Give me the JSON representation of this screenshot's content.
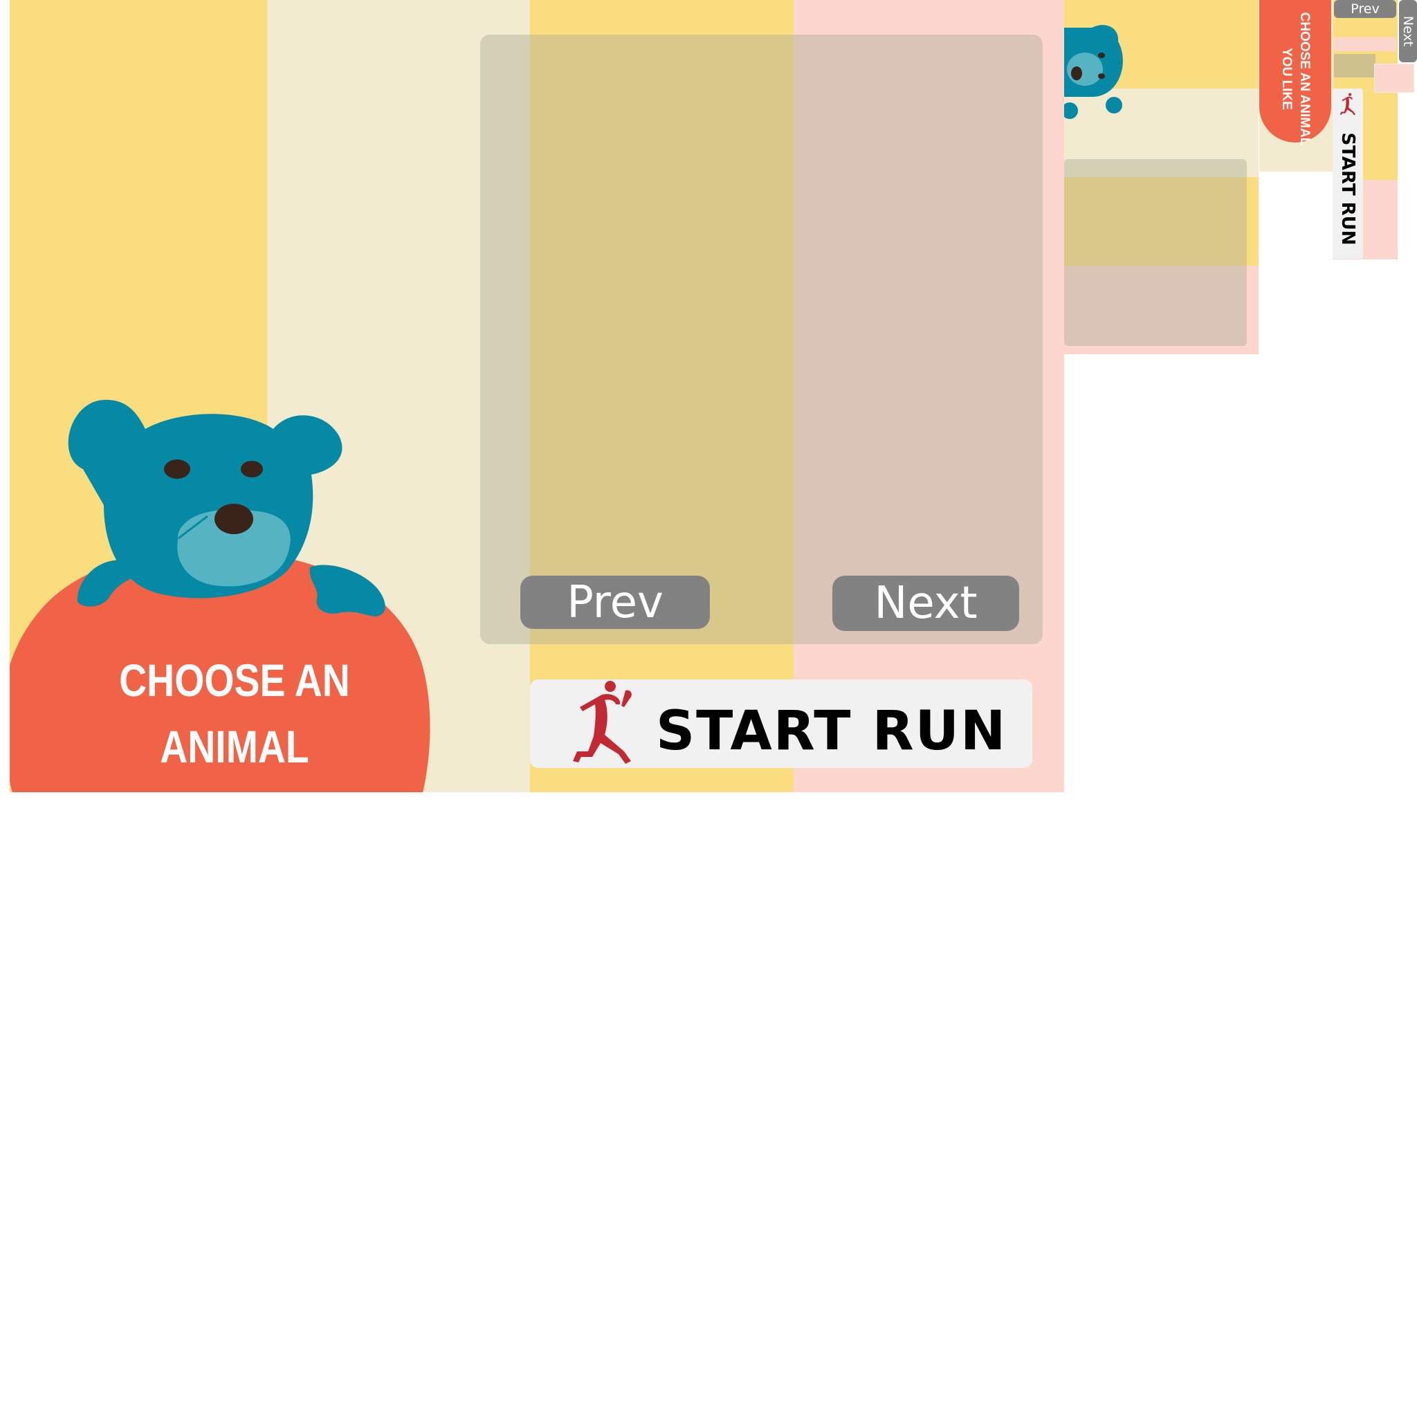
{
  "colors": {
    "stripe_yellow": "#fadd7f",
    "stripe_cream": "#f3ebd0",
    "stripe_pink": "#fdd6ce",
    "bear_teal": "#0589a4",
    "bear_muzzle": "#56b3c2",
    "sign_orange": "#f06346",
    "button_gray": "#828282",
    "runner_red": "#c22a33"
  },
  "main": {
    "title_line1": "CHOOSE AN ANIMAL",
    "title_line2": "YOU LIKE",
    "prev_label": "Prev",
    "next_label": "Next",
    "start_label": "START RUN",
    "icons": {
      "mascot": "bear-mascot-icon",
      "runner": "runner-icon"
    }
  },
  "thumb_portrait": {
    "prev_label": "Prev",
    "next_label": "Next",
    "title_line1": "CHOOSE AN ANIMAL",
    "title_line2": "YOU LIKE",
    "start_label": "START RUN"
  }
}
